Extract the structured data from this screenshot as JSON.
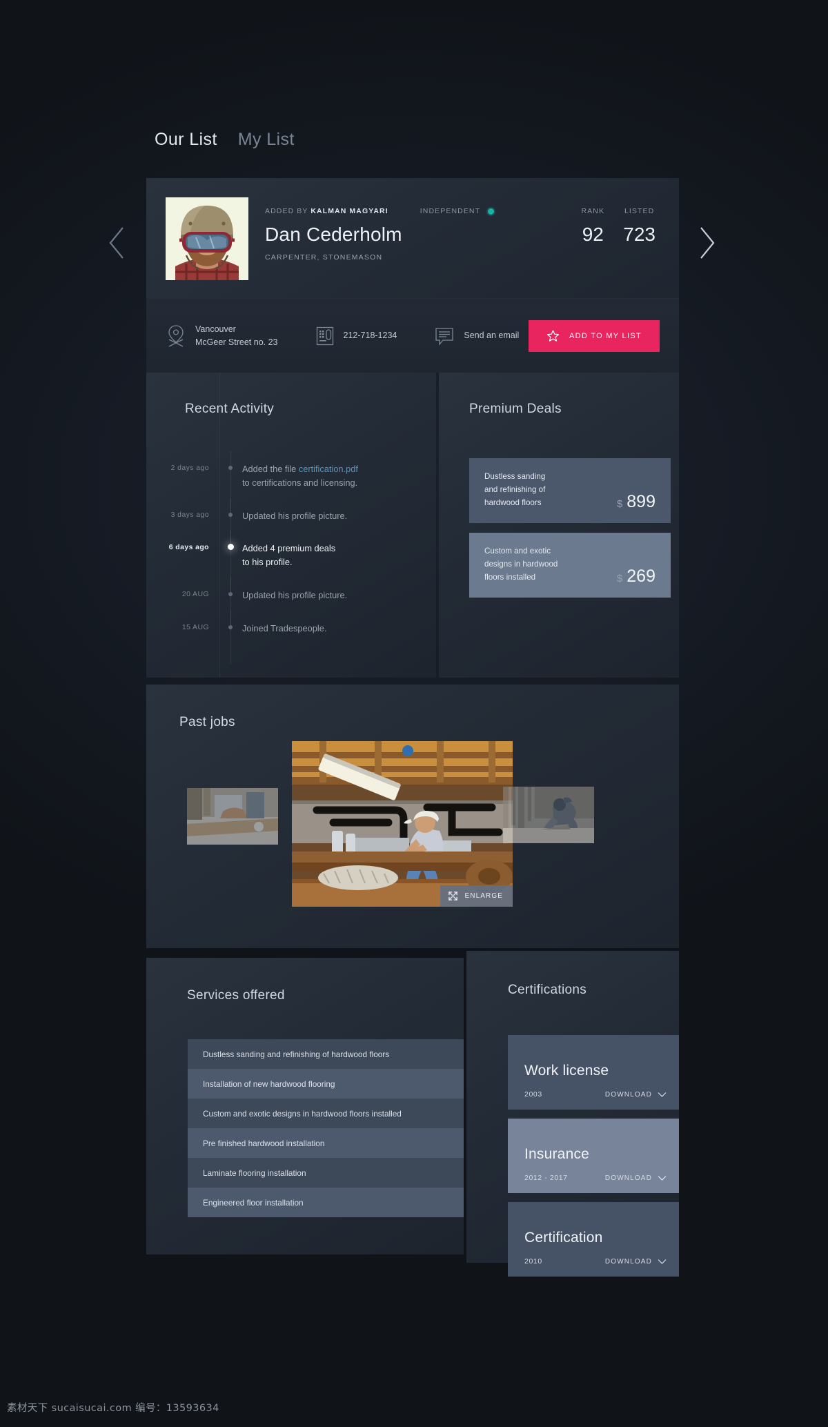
{
  "tabs": [
    {
      "label": "Our List",
      "active": true
    },
    {
      "label": "My List",
      "active": false
    }
  ],
  "nav": {
    "prev": "previous-profile",
    "next": "next-profile"
  },
  "profile": {
    "added_by_prefix": "ADDED BY",
    "added_by_name": "KALMAN MAGYARI",
    "independent_label": "INDEPENDENT",
    "name": "Dan Cederholm",
    "trades": "CARPENTER,  STONEMASON",
    "stats": [
      {
        "label": "RANK",
        "value": "92"
      },
      {
        "label": "LISTED",
        "value": "723"
      }
    ],
    "contacts": [
      {
        "icon": "location-pin-icon",
        "line1": "Vancouver",
        "line2": "McGeer Street no. 23"
      },
      {
        "icon": "telephone-icon",
        "line1": "212-718-1234",
        "line2": ""
      },
      {
        "icon": "message-bubble-icon",
        "line1": "Send an email",
        "line2": ""
      }
    ],
    "add_button": {
      "icon": "star-icon",
      "label": "ADD TO MY LIST",
      "color": "#e8255f"
    }
  },
  "activity": {
    "title": "Recent Activity",
    "items": [
      {
        "time": "2 days ago",
        "text_before": "Added the file ",
        "link": "certification.pdf",
        "text_after": "",
        "line2": "to certifications and licensing.",
        "current": false
      },
      {
        "time": "3 days ago",
        "text_before": "Updated his profile picture.",
        "link": "",
        "text_after": "",
        "line2": "",
        "current": false
      },
      {
        "time": "6 days ago",
        "text_before": "Added 4 premium deals",
        "link": "",
        "text_after": "",
        "line2": "to his profile.",
        "current": true
      },
      {
        "time": "20 AUG",
        "text_before": "Updated his profile picture.",
        "link": "",
        "text_after": "",
        "line2": "",
        "current": false
      },
      {
        "time": "15 AUG",
        "text_before": "Joined Tradespeople.",
        "link": "",
        "text_after": "",
        "line2": "",
        "current": false
      }
    ]
  },
  "deals": {
    "title": "Premium Deals",
    "currency": "$",
    "items": [
      {
        "line1": "Dustless sanding",
        "line2": "and refinishing of",
        "line3": "hardwood floors",
        "price": "899"
      },
      {
        "line1": "Custom and exotic",
        "line2": "designs in hardwood",
        "line3": "floors installed",
        "price": "269"
      }
    ]
  },
  "jobs": {
    "title": "Past jobs",
    "enlarge_label": "ENLARGE",
    "thumbs": [
      {
        "name": "job-photo-left"
      },
      {
        "name": "job-photo-main"
      },
      {
        "name": "job-photo-right"
      }
    ]
  },
  "services": {
    "title": "Services offered",
    "items": [
      "Dustless sanding and refinishing of hardwood floors",
      "Installation of new hardwood flooring",
      "Custom and exotic designs in hardwood floors installed",
      "Pre finished hardwood installation",
      "Laminate flooring installation",
      "Engineered floor installation"
    ]
  },
  "certifications": {
    "title": "Certifications",
    "download_label": "DOWNLOAD",
    "items": [
      {
        "name": "Work license",
        "year": "2003",
        "highlight": false
      },
      {
        "name": "Insurance",
        "year": "2012 - 2017",
        "highlight": true
      },
      {
        "name": "Certification",
        "year": "2010",
        "highlight": false
      }
    ]
  },
  "watermark": "素材天下 sucaisucai.com  编号：13593634"
}
